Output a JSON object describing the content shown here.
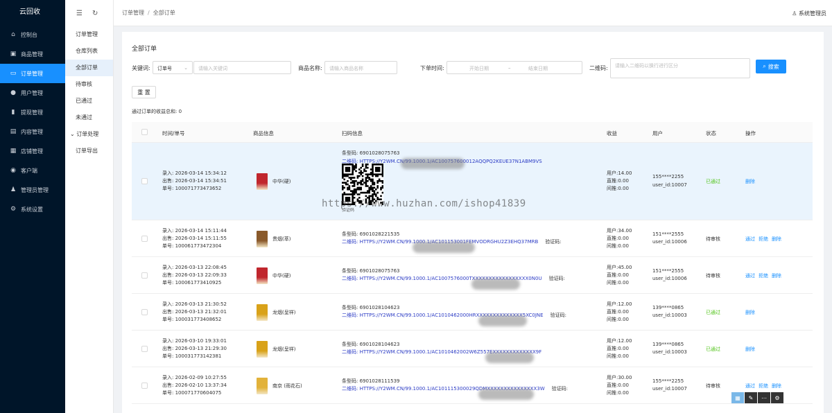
{
  "app": {
    "title": "云回收"
  },
  "sidebar": {
    "items": [
      {
        "label": "控制台",
        "icon": "home-icon",
        "glyph": "⌂"
      },
      {
        "label": "商品管理",
        "icon": "bag-icon",
        "glyph": "▣"
      },
      {
        "label": "订单管理",
        "icon": "card-icon",
        "glyph": "▭"
      },
      {
        "label": "用户管理",
        "icon": "user-icon",
        "glyph": "●"
      },
      {
        "label": "提现管理",
        "icon": "chart-icon",
        "glyph": "▮"
      },
      {
        "label": "内容管理",
        "icon": "document-icon",
        "glyph": "▤"
      },
      {
        "label": "店铺管理",
        "icon": "store-icon",
        "glyph": "▦"
      },
      {
        "label": "客户端",
        "icon": "globe-icon",
        "glyph": "◉"
      },
      {
        "label": "管理员管理",
        "icon": "admin-icon",
        "glyph": "♟"
      },
      {
        "label": "系统设置",
        "icon": "gear-icon",
        "glyph": "⚙"
      }
    ],
    "active_index": 2
  },
  "submenu": {
    "items": [
      "订单管理",
      "仓库列表",
      "全部订单",
      "待审核",
      "已通过",
      "未通过",
      "订单处理",
      "订单导出"
    ],
    "active_index": 2,
    "group_index": 6
  },
  "header": {
    "breadcrumb": [
      "订单管理",
      "全部订单"
    ],
    "user_label": "系统管理员"
  },
  "page": {
    "title": "全部订单",
    "filters": {
      "keyword_label": "关键词:",
      "keyword_type": "订单号",
      "keyword_placeholder": "请输入关键词",
      "product_label": "商品名称:",
      "product_placeholder": "请输入商品名称",
      "time_label": "下单时间:",
      "start_placeholder": "开始日期",
      "range_sep": "–",
      "end_placeholder": "结束日期",
      "qrcode_label": "二维码:",
      "qrcode_placeholder": "请输入二维码以换行进行区分",
      "search_label": "搜索",
      "reset_label": "重 置"
    },
    "summary": "通过订单的收益总和: 0"
  },
  "table": {
    "headers": [
      "时间/单号",
      "商品信息",
      "扫码信息",
      "收益",
      "用户",
      "状态",
      "操作"
    ],
    "rows": [
      {
        "in": "录入: 2026-03-14 15:34:12",
        "out": "出售: 2026-03-14 15:34:51",
        "no": "单号: 100071773473652",
        "product": "中华(硬)",
        "color": "#c0262d",
        "barcode": "条型码: 6901028075763",
        "qr_label": "二维码:",
        "qr": "HTTPS://Y2WM.CN/99.1000.1/AC100757600012AQQPQ2KEUE37N1ABM9VS",
        "verify": "",
        "earn": [
          "用户:14.00",
          "直推:0.00",
          "间推:0.00"
        ],
        "user": [
          "155****2255",
          "user_id:10007"
        ],
        "status": "已通过",
        "ok": true,
        "ops": [
          "删除"
        ]
      },
      {
        "in": "录入: 2026-03-14 15:11:44",
        "out": "出售: 2026-03-14 15:11:55",
        "no": "单号: 100061773472304",
        "product": "贵烟(萃)",
        "color": "#8a5a2b",
        "barcode": "条型码: 6901028221535",
        "qr_label": "二维码:",
        "qr": "HTTPS://Y2WM.CN/99.1000.1/AC101153001FEMVODRGHU2Z3EHQ37MRB",
        "verify": "验证码:",
        "earn": [
          "用户:34.00",
          "直推:0.00",
          "间推:0.00"
        ],
        "user": [
          "151****2555",
          "user_id:10006"
        ],
        "status": "待审核",
        "ok": false,
        "ops": [
          "通过",
          "拒绝",
          "删除"
        ]
      },
      {
        "in": "录入: 2026-03-13 22:08:45",
        "out": "出售: 2026-03-13 22:09:33",
        "no": "单号: 100061773410925",
        "product": "中华(硬)",
        "color": "#c0262d",
        "barcode": "条型码: 6901028075763",
        "qr_label": "二维码:",
        "qr": "HTTPS://Y2WM.CN/99.1000.1/AC1007576000TXXXXXXXXXXXXXXXXX0N0U",
        "verify": "验证码:",
        "earn": [
          "用户:45.00",
          "直推:0.00",
          "间推:0.00"
        ],
        "user": [
          "151****2555",
          "user_id:10006"
        ],
        "status": "待审核",
        "ok": false,
        "ops": [
          "通过",
          "拒绝",
          "删除"
        ]
      },
      {
        "in": "录入: 2026-03-13 21:30:52",
        "out": "出售: 2026-03-13 21:32:01",
        "no": "单号: 100031773408652",
        "product": "龙烟(呈祥)",
        "color": "#d9a219",
        "barcode": "条型码: 6901028104623",
        "qr_label": "二维码:",
        "qr": "HTTPS://Y2WM.CN/99.1000.1/AC1010462000HRXXXXXXXXXXXXXX5XC0JNE",
        "verify": "验证码:",
        "earn": [
          "用户:12.00",
          "直推:0.00",
          "间推:0.00"
        ],
        "user": [
          "139****0865",
          "user_id:10003"
        ],
        "status": "已通过",
        "ok": true,
        "ops": [
          "删除"
        ]
      },
      {
        "in": "录入: 2026-03-10 19:33:01",
        "out": "出售: 2026-03-13 21:29:30",
        "no": "单号: 100031773142381",
        "product": "龙烟(呈祥)",
        "color": "#d9a219",
        "barcode": "条型码: 6901028104623",
        "qr_label": "二维码:",
        "qr": "HTTPS://Y2WM.CN/99.1000.1/AC1010462002W6Z557EXXXXXXXXXXXXX9F",
        "verify": "",
        "earn": [
          "用户:12.00",
          "直推:0.00",
          "间推:0.00"
        ],
        "user": [
          "139****0865",
          "user_id:10003"
        ],
        "status": "已通过",
        "ok": true,
        "ops": [
          "删除"
        ]
      },
      {
        "in": "录入: 2026-02-09 10:27:55",
        "out": "出售: 2026-02-10 13:37:34",
        "no": "单号: 100071770604075",
        "product": "南京 (雨花石)",
        "color": "#e2b23a",
        "barcode": "条型码: 6901028111539",
        "qr_label": "二维码:",
        "qr": "HTTPS://Y2WM.CN/99.1000.1/AC101115300029QDMXXXXXXXXXXXXXXX3W",
        "verify": "验证码:",
        "earn": [
          "用户:30.00",
          "直推:0.00",
          "间推:0.00"
        ],
        "user": [
          "155****2255",
          "user_id:10007"
        ],
        "status": "待审核",
        "ok": false,
        "ops": [
          "通过",
          "拒绝",
          "删除"
        ]
      }
    ]
  },
  "watermark": "https://www.huzhan.com/ishop41839",
  "qr_caption": "验证码",
  "floatbar": [
    "▦",
    "✎",
    "⋯",
    "⚙"
  ]
}
